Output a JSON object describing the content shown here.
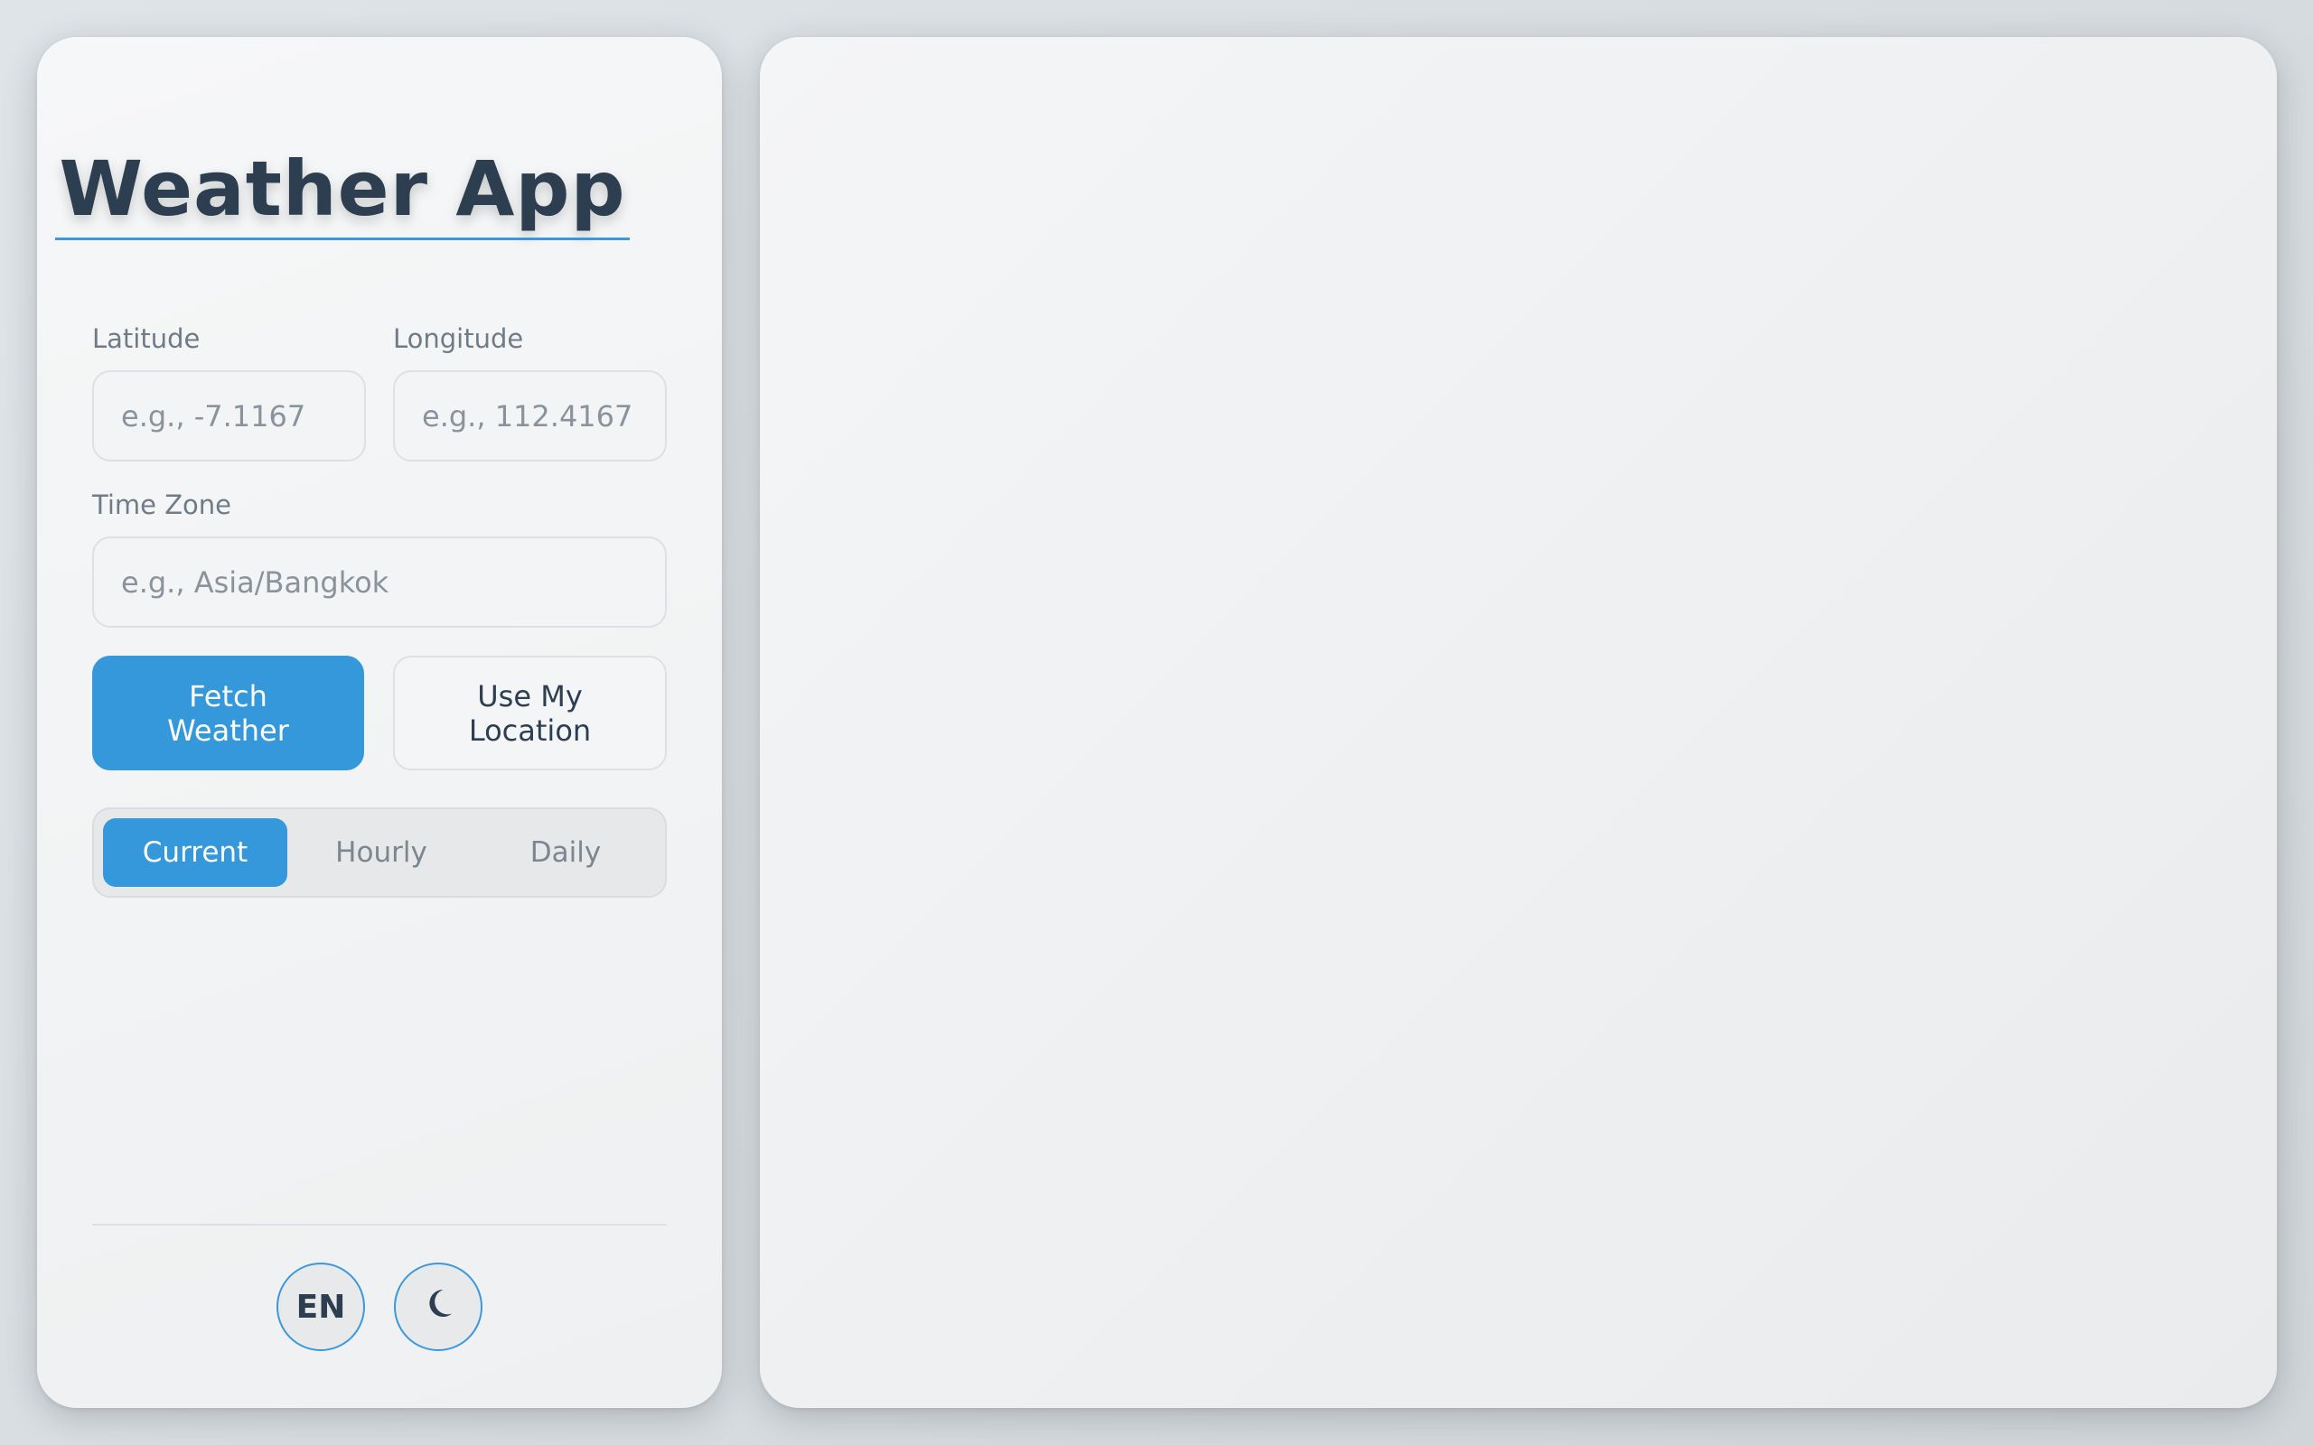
{
  "app": {
    "title": "Weather App"
  },
  "form": {
    "latitude_label": "Latitude",
    "latitude_placeholder": "e.g., -7.1167",
    "longitude_label": "Longitude",
    "longitude_placeholder": "e.g., 112.4167",
    "timezone_label": "Time Zone",
    "timezone_placeholder": "e.g., Asia/Bangkok"
  },
  "actions": {
    "fetch_label": "Fetch Weather",
    "location_label": "Use My Location"
  },
  "tabs": [
    {
      "label": "Current",
      "active": true
    },
    {
      "label": "Hourly",
      "active": false
    },
    {
      "label": "Daily",
      "active": false
    }
  ],
  "footer": {
    "language_label": "EN",
    "theme_icon": "moon-icon"
  },
  "colors": {
    "accent": "#3498db",
    "text": "#2c3e50"
  }
}
